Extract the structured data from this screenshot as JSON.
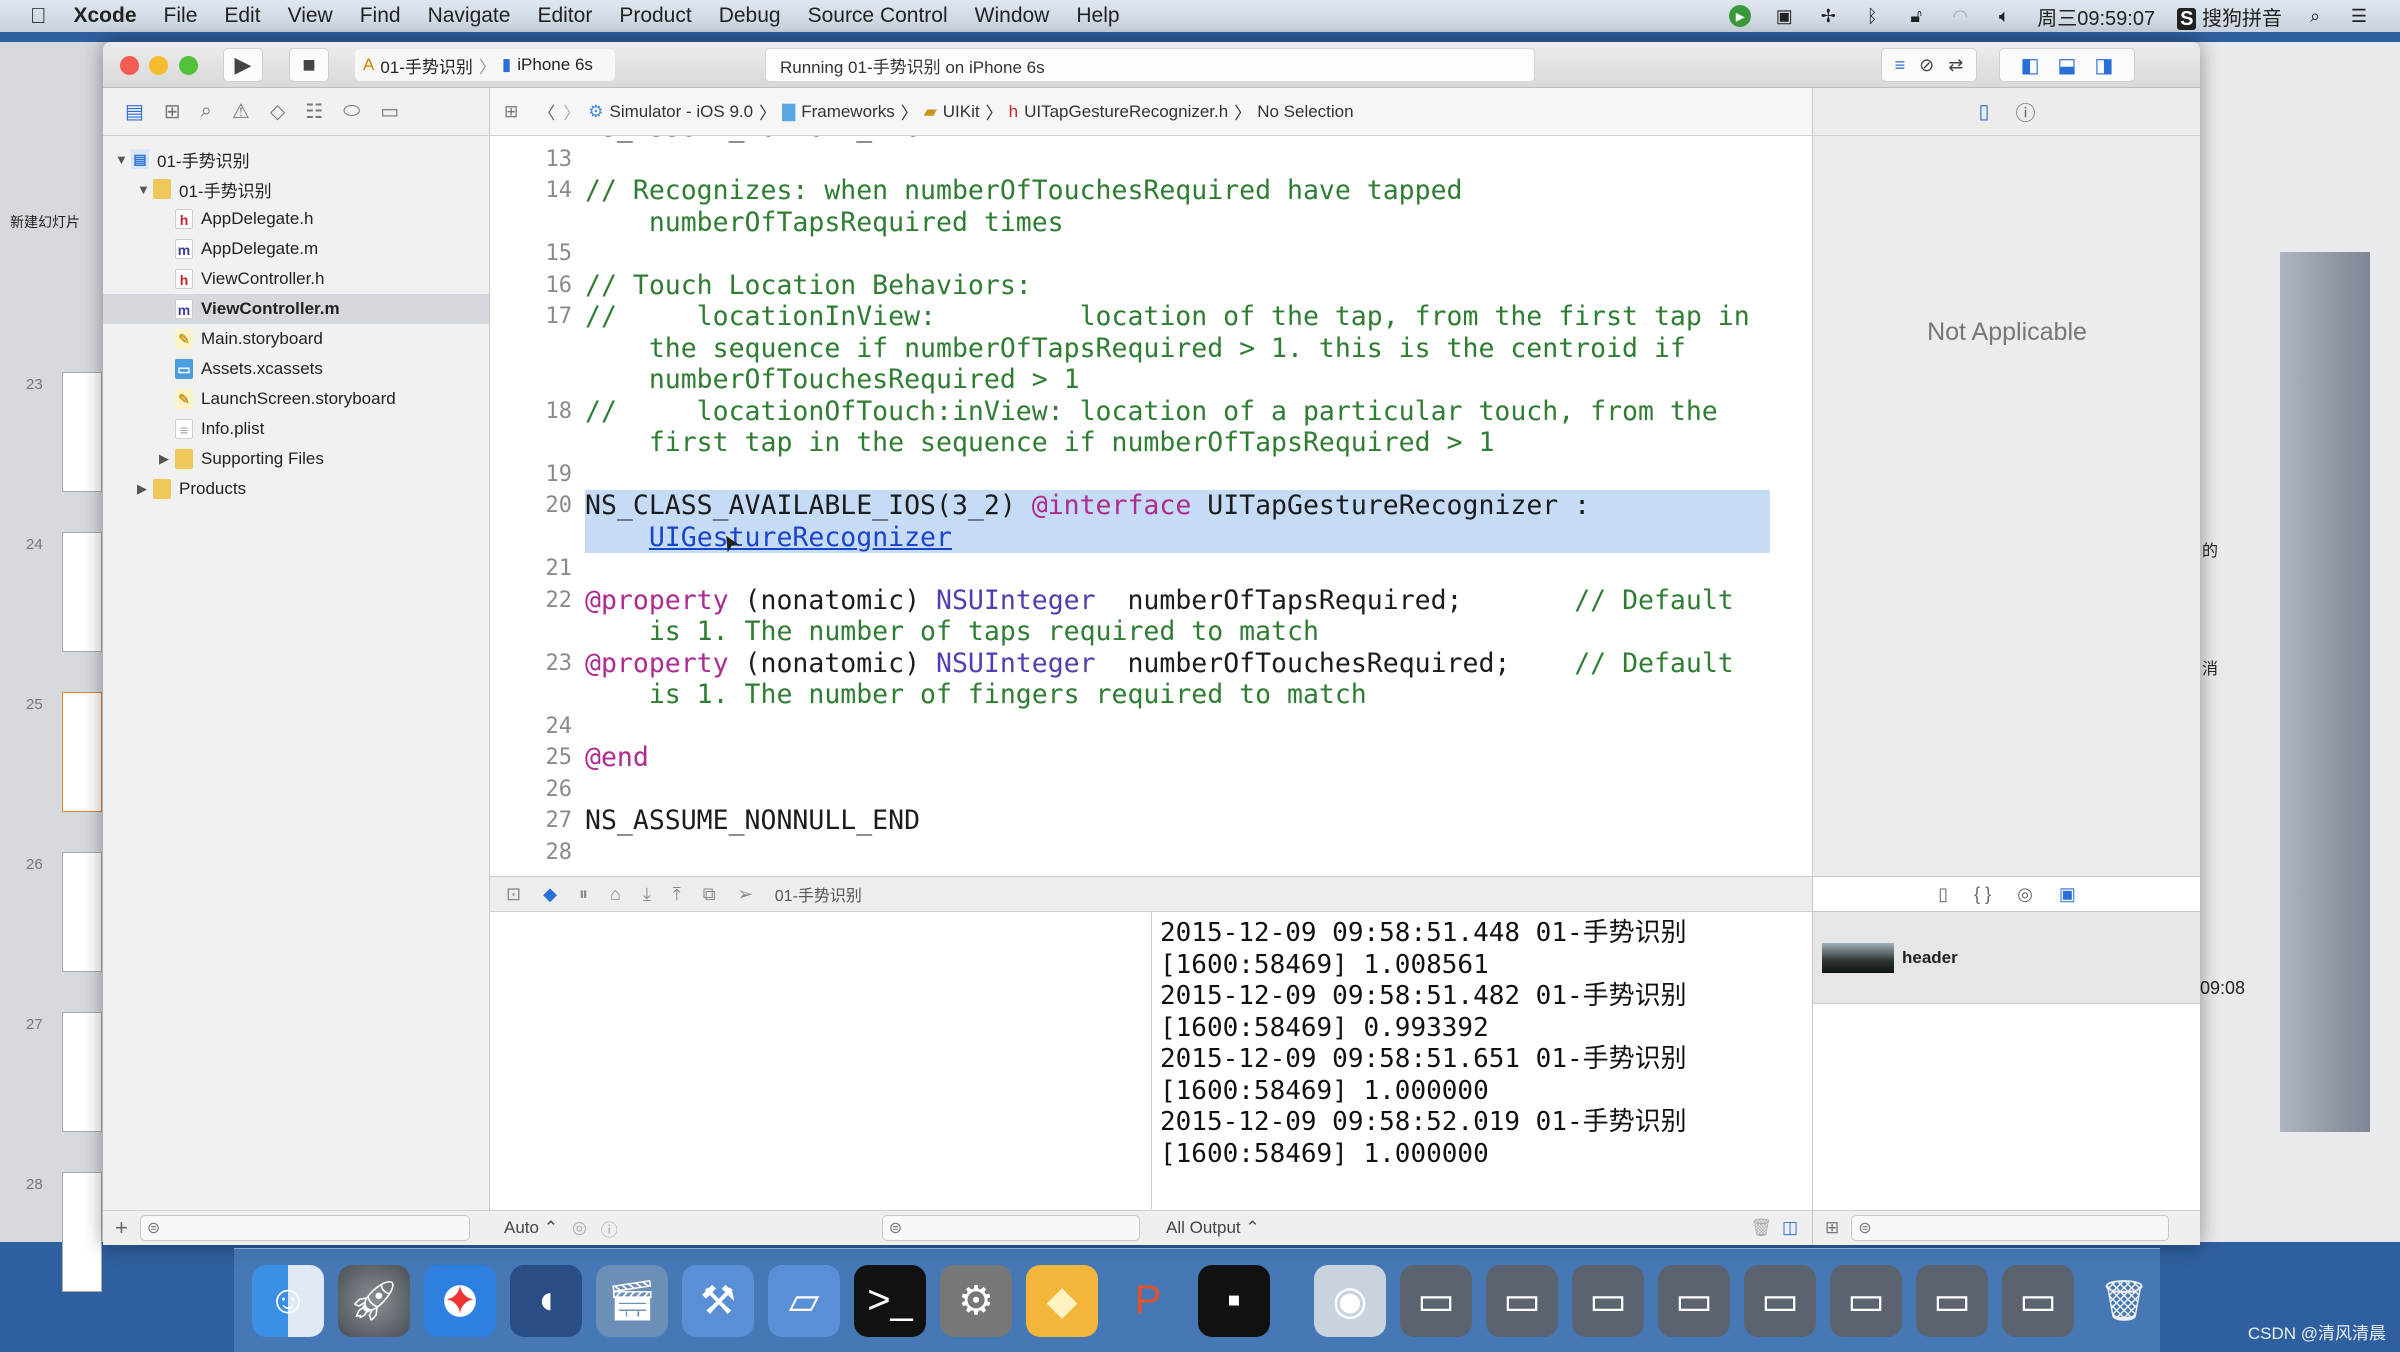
{
  "menubar": {
    "apple_icon": "apple-icon",
    "app": "Xcode",
    "items": [
      "File",
      "Edit",
      "View",
      "Find",
      "Navigate",
      "Editor",
      "Product",
      "Debug",
      "Source Control",
      "Window",
      "Help"
    ],
    "clock": "周三09:59:07",
    "input_method": "搜狗拼音",
    "status_icons": [
      "app-status-icon",
      "video-icon",
      "fan-icon",
      "bluetooth-icon",
      "lock-icon",
      "wifi-icon",
      "volume-icon"
    ]
  },
  "background_app": {
    "new_slide_label": "新建幻灯片",
    "slide_numbers": [
      "23",
      "24",
      "25",
      "26",
      "27",
      "28"
    ]
  },
  "toolbar": {
    "scheme": "01-手势识别",
    "device": "iPhone 6s",
    "activity": "Running 01-手势识别 on iPhone 6s"
  },
  "navigator": {
    "items": [
      {
        "label": "01-手势识别",
        "type": "project",
        "depth": 0,
        "open": true
      },
      {
        "label": "01-手势识别",
        "type": "folder",
        "depth": 1,
        "open": true
      },
      {
        "label": "AppDelegate.h",
        "type": "h",
        "depth": 2
      },
      {
        "label": "AppDelegate.m",
        "type": "m",
        "depth": 2
      },
      {
        "label": "ViewController.h",
        "type": "h",
        "depth": 2
      },
      {
        "label": "ViewController.m",
        "type": "m",
        "depth": 2,
        "selected": true
      },
      {
        "label": "Main.storyboard",
        "type": "storyboard",
        "depth": 2
      },
      {
        "label": "Assets.xcassets",
        "type": "assets",
        "depth": 2
      },
      {
        "label": "LaunchScreen.storyboard",
        "type": "storyboard",
        "depth": 2
      },
      {
        "label": "Info.plist",
        "type": "plist",
        "depth": 2
      },
      {
        "label": "Supporting Files",
        "type": "folder",
        "depth": 2,
        "open": false
      },
      {
        "label": "Products",
        "type": "folder",
        "depth": 1,
        "open": false
      }
    ]
  },
  "jumpbar": [
    "Simulator - iOS 9.0",
    "Frameworks",
    "UIKit",
    "UITapGestureRecognizer.h",
    "No Selection"
  ],
  "code": [
    {
      "n": "",
      "s": [
        [
          "NS_ASSUME_NONNULL_BEGIN",
          "plain"
        ]
      ]
    },
    {
      "n": "13",
      "s": []
    },
    {
      "n": "14",
      "s": [
        [
          "// Recognizes: when numberOfTouchesRequired have tapped",
          "comment"
        ]
      ]
    },
    {
      "n": "",
      "s": [
        [
          "    numberOfTapsRequired times",
          "comment"
        ]
      ]
    },
    {
      "n": "15",
      "s": []
    },
    {
      "n": "16",
      "s": [
        [
          "// Touch Location Behaviors:",
          "comment"
        ]
      ]
    },
    {
      "n": "17",
      "s": [
        [
          "//     locationInView:         location of the tap, from the first tap in",
          "comment"
        ]
      ]
    },
    {
      "n": "",
      "s": [
        [
          "    the sequence if numberOfTapsRequired > 1. this is the centroid if",
          "comment"
        ]
      ]
    },
    {
      "n": "",
      "s": [
        [
          "    numberOfTouchesRequired > 1",
          "comment"
        ]
      ]
    },
    {
      "n": "18",
      "s": [
        [
          "//     locationOfTouch:inView: location of a particular touch, from the",
          "comment"
        ]
      ]
    },
    {
      "n": "",
      "s": [
        [
          "    first tap in the sequence if numberOfTapsRequired > 1",
          "comment"
        ]
      ]
    },
    {
      "n": "19",
      "s": []
    },
    {
      "n": "20",
      "hl": true,
      "s": [
        [
          "NS_CLASS_AVAILABLE_IOS(3_2) ",
          "plain"
        ],
        [
          "@interface",
          "kw"
        ],
        [
          " UITapGestureRecognizer :",
          "plain"
        ]
      ]
    },
    {
      "n": "",
      "hl": true,
      "s": [
        [
          "    ",
          "plain"
        ],
        [
          "UIGestureRecognizer",
          "link"
        ]
      ]
    },
    {
      "n": "21",
      "s": []
    },
    {
      "n": "22",
      "s": [
        [
          "@property",
          "kw"
        ],
        [
          " (nonatomic) ",
          "plain"
        ],
        [
          "NSUInteger",
          "type"
        ],
        [
          "  numberOfTapsRequired;       ",
          "plain"
        ],
        [
          "// Default",
          "comment"
        ]
      ]
    },
    {
      "n": "",
      "s": [
        [
          "    is 1. The number of taps required to match",
          "comment"
        ]
      ]
    },
    {
      "n": "23",
      "s": [
        [
          "@property",
          "kw"
        ],
        [
          " (nonatomic) ",
          "plain"
        ],
        [
          "NSUInteger",
          "type"
        ],
        [
          "  numberOfTouchesRequired;    ",
          "plain"
        ],
        [
          "// Default",
          "comment"
        ]
      ]
    },
    {
      "n": "",
      "s": [
        [
          "    is 1. The number of fingers required to match",
          "comment"
        ]
      ]
    },
    {
      "n": "24",
      "s": []
    },
    {
      "n": "25",
      "s": [
        [
          "@end",
          "kw"
        ]
      ]
    },
    {
      "n": "26",
      "s": []
    },
    {
      "n": "27",
      "s": [
        [
          "NS_ASSUME_NONNULL_END",
          "plain"
        ]
      ]
    },
    {
      "n": "28",
      "s": []
    }
  ],
  "debugbar": {
    "process": "01-手势识别"
  },
  "console": {
    "lines": [
      "2015-12-09 09:58:51.448 01-手势识别",
      "[1600:58469] 1.008561",
      "2015-12-09 09:58:51.482 01-手势识别",
      "[1600:58469] 0.993392",
      "2015-12-09 09:58:51.651 01-手势识别",
      "[1600:58469] 1.000000",
      "2015-12-09 09:58:52.019 01-手势识别",
      "[1600:58469] 1.000000"
    ],
    "output_selector": "All Output ⌃"
  },
  "variables": {
    "scope_selector": "Auto ⌃"
  },
  "inspector": {
    "empty_text": "Not Applicable",
    "library_item": "header"
  },
  "background_right": {
    "fragments": [
      "的",
      "消",
      "09:08"
    ]
  },
  "dock": [
    "finder",
    "launchpad",
    "safari",
    "mouse-app",
    "imovie",
    "xcode",
    "instruments",
    "terminal",
    "system-preferences",
    "sketch",
    "powerpoint",
    "console",
    "quicktime",
    "window-1",
    "window-2",
    "window-3",
    "window-4",
    "window-5",
    "window-6",
    "window-7",
    "window-8",
    "trash"
  ],
  "watermark": "CSDN @清风清晨"
}
